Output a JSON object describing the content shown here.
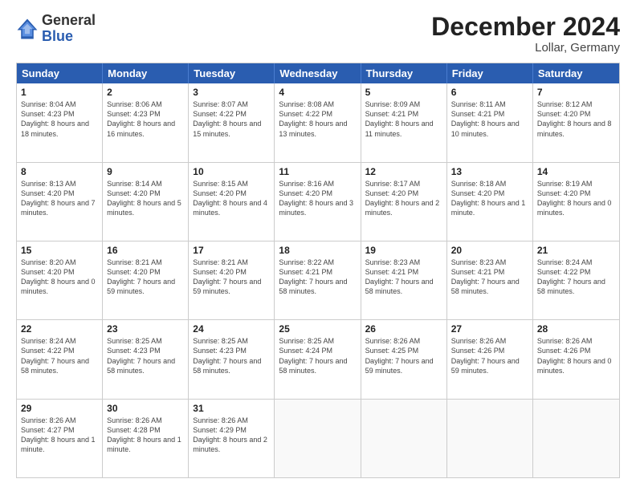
{
  "header": {
    "logo_general": "General",
    "logo_blue": "Blue",
    "month_year": "December 2024",
    "location": "Lollar, Germany"
  },
  "calendar": {
    "days": [
      "Sunday",
      "Monday",
      "Tuesday",
      "Wednesday",
      "Thursday",
      "Friday",
      "Saturday"
    ],
    "rows": [
      [
        {
          "day": "1",
          "sunrise": "8:04 AM",
          "sunset": "4:23 PM",
          "daylight": "8 hours and 18 minutes."
        },
        {
          "day": "2",
          "sunrise": "8:06 AM",
          "sunset": "4:23 PM",
          "daylight": "8 hours and 16 minutes."
        },
        {
          "day": "3",
          "sunrise": "8:07 AM",
          "sunset": "4:22 PM",
          "daylight": "8 hours and 15 minutes."
        },
        {
          "day": "4",
          "sunrise": "8:08 AM",
          "sunset": "4:22 PM",
          "daylight": "8 hours and 13 minutes."
        },
        {
          "day": "5",
          "sunrise": "8:09 AM",
          "sunset": "4:21 PM",
          "daylight": "8 hours and 11 minutes."
        },
        {
          "day": "6",
          "sunrise": "8:11 AM",
          "sunset": "4:21 PM",
          "daylight": "8 hours and 10 minutes."
        },
        {
          "day": "7",
          "sunrise": "8:12 AM",
          "sunset": "4:20 PM",
          "daylight": "8 hours and 8 minutes."
        }
      ],
      [
        {
          "day": "8",
          "sunrise": "8:13 AM",
          "sunset": "4:20 PM",
          "daylight": "8 hours and 7 minutes."
        },
        {
          "day": "9",
          "sunrise": "8:14 AM",
          "sunset": "4:20 PM",
          "daylight": "8 hours and 5 minutes."
        },
        {
          "day": "10",
          "sunrise": "8:15 AM",
          "sunset": "4:20 PM",
          "daylight": "8 hours and 4 minutes."
        },
        {
          "day": "11",
          "sunrise": "8:16 AM",
          "sunset": "4:20 PM",
          "daylight": "8 hours and 3 minutes."
        },
        {
          "day": "12",
          "sunrise": "8:17 AM",
          "sunset": "4:20 PM",
          "daylight": "8 hours and 2 minutes."
        },
        {
          "day": "13",
          "sunrise": "8:18 AM",
          "sunset": "4:20 PM",
          "daylight": "8 hours and 1 minute."
        },
        {
          "day": "14",
          "sunrise": "8:19 AM",
          "sunset": "4:20 PM",
          "daylight": "8 hours and 0 minutes."
        }
      ],
      [
        {
          "day": "15",
          "sunrise": "8:20 AM",
          "sunset": "4:20 PM",
          "daylight": "8 hours and 0 minutes."
        },
        {
          "day": "16",
          "sunrise": "8:21 AM",
          "sunset": "4:20 PM",
          "daylight": "7 hours and 59 minutes."
        },
        {
          "day": "17",
          "sunrise": "8:21 AM",
          "sunset": "4:20 PM",
          "daylight": "7 hours and 59 minutes."
        },
        {
          "day": "18",
          "sunrise": "8:22 AM",
          "sunset": "4:21 PM",
          "daylight": "7 hours and 58 minutes."
        },
        {
          "day": "19",
          "sunrise": "8:23 AM",
          "sunset": "4:21 PM",
          "daylight": "7 hours and 58 minutes."
        },
        {
          "day": "20",
          "sunrise": "8:23 AM",
          "sunset": "4:21 PM",
          "daylight": "7 hours and 58 minutes."
        },
        {
          "day": "21",
          "sunrise": "8:24 AM",
          "sunset": "4:22 PM",
          "daylight": "7 hours and 58 minutes."
        }
      ],
      [
        {
          "day": "22",
          "sunrise": "8:24 AM",
          "sunset": "4:22 PM",
          "daylight": "7 hours and 58 minutes."
        },
        {
          "day": "23",
          "sunrise": "8:25 AM",
          "sunset": "4:23 PM",
          "daylight": "7 hours and 58 minutes."
        },
        {
          "day": "24",
          "sunrise": "8:25 AM",
          "sunset": "4:23 PM",
          "daylight": "7 hours and 58 minutes."
        },
        {
          "day": "25",
          "sunrise": "8:25 AM",
          "sunset": "4:24 PM",
          "daylight": "7 hours and 58 minutes."
        },
        {
          "day": "26",
          "sunrise": "8:26 AM",
          "sunset": "4:25 PM",
          "daylight": "7 hours and 59 minutes."
        },
        {
          "day": "27",
          "sunrise": "8:26 AM",
          "sunset": "4:26 PM",
          "daylight": "7 hours and 59 minutes."
        },
        {
          "day": "28",
          "sunrise": "8:26 AM",
          "sunset": "4:26 PM",
          "daylight": "8 hours and 0 minutes."
        }
      ],
      [
        {
          "day": "29",
          "sunrise": "8:26 AM",
          "sunset": "4:27 PM",
          "daylight": "8 hours and 1 minute."
        },
        {
          "day": "30",
          "sunrise": "8:26 AM",
          "sunset": "4:28 PM",
          "daylight": "8 hours and 1 minute."
        },
        {
          "day": "31",
          "sunrise": "8:26 AM",
          "sunset": "4:29 PM",
          "daylight": "8 hours and 2 minutes."
        },
        null,
        null,
        null,
        null
      ]
    ],
    "labels": {
      "sunrise": "Sunrise:",
      "sunset": "Sunset:",
      "daylight": "Daylight:"
    }
  }
}
